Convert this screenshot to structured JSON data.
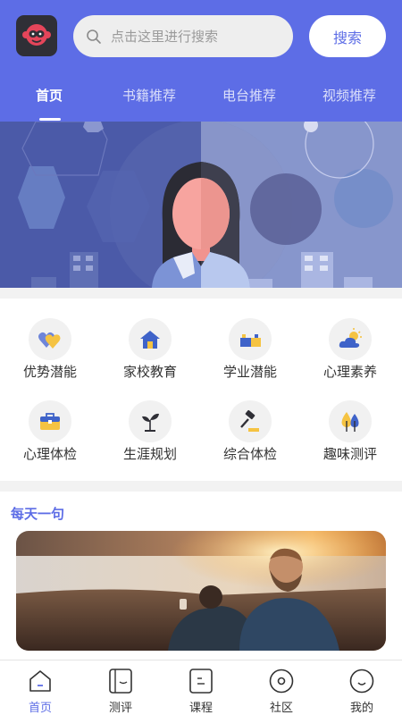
{
  "header": {
    "search_placeholder": "点击这里进行搜索",
    "search_button": "搜索",
    "tabs": [
      {
        "label": "首页",
        "active": true
      },
      {
        "label": "书籍推荐",
        "active": false
      },
      {
        "label": "电台推荐",
        "active": false
      },
      {
        "label": "视频推荐",
        "active": false
      }
    ]
  },
  "categories": [
    {
      "label": "优势潜能",
      "icon": "hearts-icon"
    },
    {
      "label": "家校教育",
      "icon": "house-icon"
    },
    {
      "label": "学业潜能",
      "icon": "blocks-icon"
    },
    {
      "label": "心理素养",
      "icon": "sun-cloud-icon"
    },
    {
      "label": "心理体检",
      "icon": "briefcase-icon"
    },
    {
      "label": "生涯规划",
      "icon": "sprout-icon"
    },
    {
      "label": "综合体检",
      "icon": "gavel-icon"
    },
    {
      "label": "趣味测评",
      "icon": "trees-icon"
    }
  ],
  "daily": {
    "title": "每天一句"
  },
  "bottom_nav": [
    {
      "label": "首页",
      "icon": "home-icon",
      "active": true
    },
    {
      "label": "测评",
      "icon": "assessment-icon",
      "active": false
    },
    {
      "label": "课程",
      "icon": "course-icon",
      "active": false
    },
    {
      "label": "社区",
      "icon": "community-icon",
      "active": false
    },
    {
      "label": "我的",
      "icon": "profile-icon",
      "active": false
    }
  ],
  "colors": {
    "primary": "#5d6de6",
    "header_bg": "#5d6de6",
    "icon_bg": "#f1f1f1"
  }
}
